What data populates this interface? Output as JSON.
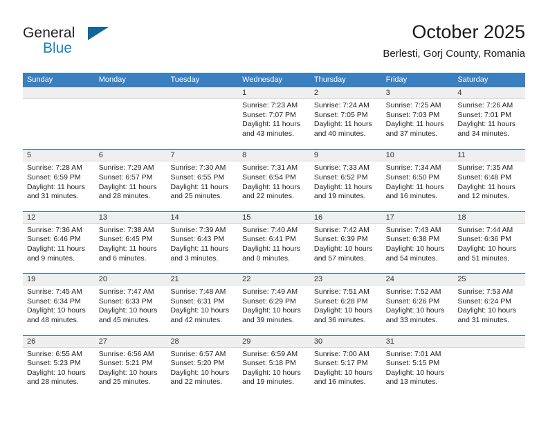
{
  "brand": {
    "name_part1": "General",
    "name_part2": "Blue",
    "logo_icon": "triangle-logo-icon"
  },
  "header": {
    "title": "October 2025",
    "subtitle": "Berlesti, Gorj County, Romania"
  },
  "colors": {
    "header_blue": "#3a7fc0",
    "row_divider_blue": "#2e6da4",
    "day_band_gray": "#efefef",
    "brand_blue": "#1a7fc1",
    "logo_blue": "#10659f"
  },
  "weekdays": [
    "Sunday",
    "Monday",
    "Tuesday",
    "Wednesday",
    "Thursday",
    "Friday",
    "Saturday"
  ],
  "weeks": [
    [
      {
        "day": "",
        "empty": true,
        "sunrise": "",
        "sunset": "",
        "daylight1": "",
        "daylight2": ""
      },
      {
        "day": "",
        "empty": true,
        "sunrise": "",
        "sunset": "",
        "daylight1": "",
        "daylight2": ""
      },
      {
        "day": "",
        "empty": true,
        "sunrise": "",
        "sunset": "",
        "daylight1": "",
        "daylight2": ""
      },
      {
        "day": "1",
        "empty": false,
        "sunrise": "Sunrise: 7:23 AM",
        "sunset": "Sunset: 7:07 PM",
        "daylight1": "Daylight: 11 hours",
        "daylight2": "and 43 minutes."
      },
      {
        "day": "2",
        "empty": false,
        "sunrise": "Sunrise: 7:24 AM",
        "sunset": "Sunset: 7:05 PM",
        "daylight1": "Daylight: 11 hours",
        "daylight2": "and 40 minutes."
      },
      {
        "day": "3",
        "empty": false,
        "sunrise": "Sunrise: 7:25 AM",
        "sunset": "Sunset: 7:03 PM",
        "daylight1": "Daylight: 11 hours",
        "daylight2": "and 37 minutes."
      },
      {
        "day": "4",
        "empty": false,
        "sunrise": "Sunrise: 7:26 AM",
        "sunset": "Sunset: 7:01 PM",
        "daylight1": "Daylight: 11 hours",
        "daylight2": "and 34 minutes."
      }
    ],
    [
      {
        "day": "5",
        "empty": false,
        "sunrise": "Sunrise: 7:28 AM",
        "sunset": "Sunset: 6:59 PM",
        "daylight1": "Daylight: 11 hours",
        "daylight2": "and 31 minutes."
      },
      {
        "day": "6",
        "empty": false,
        "sunrise": "Sunrise: 7:29 AM",
        "sunset": "Sunset: 6:57 PM",
        "daylight1": "Daylight: 11 hours",
        "daylight2": "and 28 minutes."
      },
      {
        "day": "7",
        "empty": false,
        "sunrise": "Sunrise: 7:30 AM",
        "sunset": "Sunset: 6:55 PM",
        "daylight1": "Daylight: 11 hours",
        "daylight2": "and 25 minutes."
      },
      {
        "day": "8",
        "empty": false,
        "sunrise": "Sunrise: 7:31 AM",
        "sunset": "Sunset: 6:54 PM",
        "daylight1": "Daylight: 11 hours",
        "daylight2": "and 22 minutes."
      },
      {
        "day": "9",
        "empty": false,
        "sunrise": "Sunrise: 7:33 AM",
        "sunset": "Sunset: 6:52 PM",
        "daylight1": "Daylight: 11 hours",
        "daylight2": "and 19 minutes."
      },
      {
        "day": "10",
        "empty": false,
        "sunrise": "Sunrise: 7:34 AM",
        "sunset": "Sunset: 6:50 PM",
        "daylight1": "Daylight: 11 hours",
        "daylight2": "and 16 minutes."
      },
      {
        "day": "11",
        "empty": false,
        "sunrise": "Sunrise: 7:35 AM",
        "sunset": "Sunset: 6:48 PM",
        "daylight1": "Daylight: 11 hours",
        "daylight2": "and 12 minutes."
      }
    ],
    [
      {
        "day": "12",
        "empty": false,
        "sunrise": "Sunrise: 7:36 AM",
        "sunset": "Sunset: 6:46 PM",
        "daylight1": "Daylight: 11 hours",
        "daylight2": "and 9 minutes."
      },
      {
        "day": "13",
        "empty": false,
        "sunrise": "Sunrise: 7:38 AM",
        "sunset": "Sunset: 6:45 PM",
        "daylight1": "Daylight: 11 hours",
        "daylight2": "and 6 minutes."
      },
      {
        "day": "14",
        "empty": false,
        "sunrise": "Sunrise: 7:39 AM",
        "sunset": "Sunset: 6:43 PM",
        "daylight1": "Daylight: 11 hours",
        "daylight2": "and 3 minutes."
      },
      {
        "day": "15",
        "empty": false,
        "sunrise": "Sunrise: 7:40 AM",
        "sunset": "Sunset: 6:41 PM",
        "daylight1": "Daylight: 11 hours",
        "daylight2": "and 0 minutes."
      },
      {
        "day": "16",
        "empty": false,
        "sunrise": "Sunrise: 7:42 AM",
        "sunset": "Sunset: 6:39 PM",
        "daylight1": "Daylight: 10 hours",
        "daylight2": "and 57 minutes."
      },
      {
        "day": "17",
        "empty": false,
        "sunrise": "Sunrise: 7:43 AM",
        "sunset": "Sunset: 6:38 PM",
        "daylight1": "Daylight: 10 hours",
        "daylight2": "and 54 minutes."
      },
      {
        "day": "18",
        "empty": false,
        "sunrise": "Sunrise: 7:44 AM",
        "sunset": "Sunset: 6:36 PM",
        "daylight1": "Daylight: 10 hours",
        "daylight2": "and 51 minutes."
      }
    ],
    [
      {
        "day": "19",
        "empty": false,
        "sunrise": "Sunrise: 7:45 AM",
        "sunset": "Sunset: 6:34 PM",
        "daylight1": "Daylight: 10 hours",
        "daylight2": "and 48 minutes."
      },
      {
        "day": "20",
        "empty": false,
        "sunrise": "Sunrise: 7:47 AM",
        "sunset": "Sunset: 6:33 PM",
        "daylight1": "Daylight: 10 hours",
        "daylight2": "and 45 minutes."
      },
      {
        "day": "21",
        "empty": false,
        "sunrise": "Sunrise: 7:48 AM",
        "sunset": "Sunset: 6:31 PM",
        "daylight1": "Daylight: 10 hours",
        "daylight2": "and 42 minutes."
      },
      {
        "day": "22",
        "empty": false,
        "sunrise": "Sunrise: 7:49 AM",
        "sunset": "Sunset: 6:29 PM",
        "daylight1": "Daylight: 10 hours",
        "daylight2": "and 39 minutes."
      },
      {
        "day": "23",
        "empty": false,
        "sunrise": "Sunrise: 7:51 AM",
        "sunset": "Sunset: 6:28 PM",
        "daylight1": "Daylight: 10 hours",
        "daylight2": "and 36 minutes."
      },
      {
        "day": "24",
        "empty": false,
        "sunrise": "Sunrise: 7:52 AM",
        "sunset": "Sunset: 6:26 PM",
        "daylight1": "Daylight: 10 hours",
        "daylight2": "and 33 minutes."
      },
      {
        "day": "25",
        "empty": false,
        "sunrise": "Sunrise: 7:53 AM",
        "sunset": "Sunset: 6:24 PM",
        "daylight1": "Daylight: 10 hours",
        "daylight2": "and 31 minutes."
      }
    ],
    [
      {
        "day": "26",
        "empty": false,
        "sunrise": "Sunrise: 6:55 AM",
        "sunset": "Sunset: 5:23 PM",
        "daylight1": "Daylight: 10 hours",
        "daylight2": "and 28 minutes."
      },
      {
        "day": "27",
        "empty": false,
        "sunrise": "Sunrise: 6:56 AM",
        "sunset": "Sunset: 5:21 PM",
        "daylight1": "Daylight: 10 hours",
        "daylight2": "and 25 minutes."
      },
      {
        "day": "28",
        "empty": false,
        "sunrise": "Sunrise: 6:57 AM",
        "sunset": "Sunset: 5:20 PM",
        "daylight1": "Daylight: 10 hours",
        "daylight2": "and 22 minutes."
      },
      {
        "day": "29",
        "empty": false,
        "sunrise": "Sunrise: 6:59 AM",
        "sunset": "Sunset: 5:18 PM",
        "daylight1": "Daylight: 10 hours",
        "daylight2": "and 19 minutes."
      },
      {
        "day": "30",
        "empty": false,
        "sunrise": "Sunrise: 7:00 AM",
        "sunset": "Sunset: 5:17 PM",
        "daylight1": "Daylight: 10 hours",
        "daylight2": "and 16 minutes."
      },
      {
        "day": "31",
        "empty": false,
        "sunrise": "Sunrise: 7:01 AM",
        "sunset": "Sunset: 5:15 PM",
        "daylight1": "Daylight: 10 hours",
        "daylight2": "and 13 minutes."
      },
      {
        "day": "",
        "empty": true,
        "sunrise": "",
        "sunset": "",
        "daylight1": "",
        "daylight2": ""
      }
    ]
  ]
}
